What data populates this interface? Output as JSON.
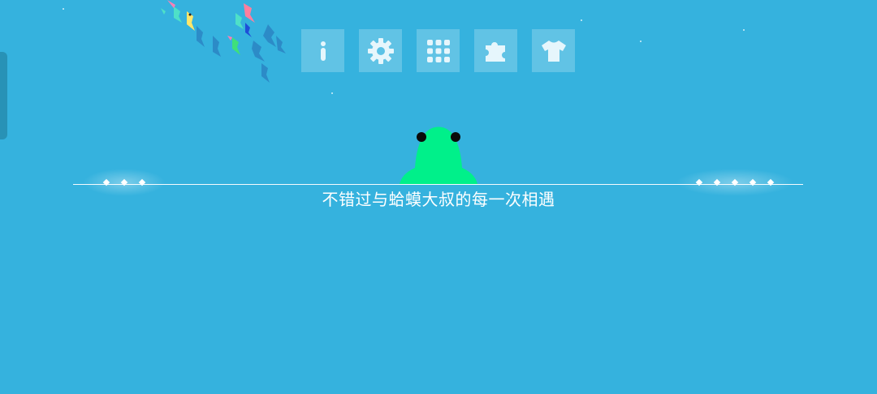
{
  "toolbar": {
    "buttons": [
      {
        "name": "info-button",
        "icon": "info-icon"
      },
      {
        "name": "settings-button",
        "icon": "gear-icon"
      },
      {
        "name": "levels-button",
        "icon": "grid-icon"
      },
      {
        "name": "puzzle-button",
        "icon": "puzzle-icon"
      },
      {
        "name": "skins-button",
        "icon": "tshirt-icon"
      }
    ]
  },
  "caption": "不错过与蛤蟆大叔的每一次相遇",
  "colors": {
    "background": "#35b2de",
    "frog": "#00f08a",
    "frog_eyes": "#0a0a0a",
    "button_bg": "rgba(255,255,255,0.22)",
    "icon": "#ffffff"
  }
}
